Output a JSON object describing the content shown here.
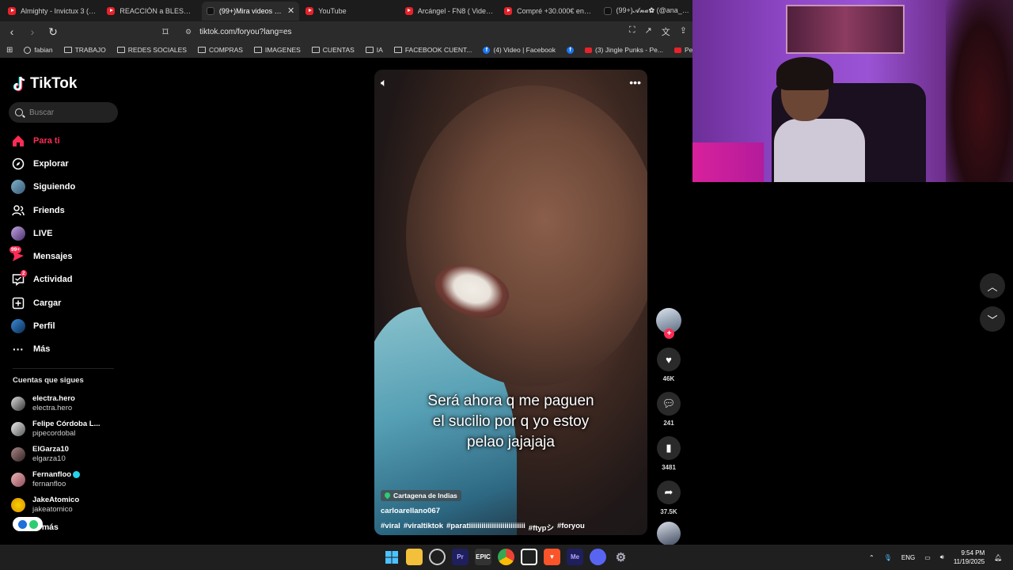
{
  "browser": {
    "tabs": [
      {
        "label": "Almighty - Invictux 3 (Tira",
        "icon": "youtube-icon",
        "active": false
      },
      {
        "label": "REACCIÓN a BLESSD - HU",
        "icon": "youtube-icon",
        "active": false
      },
      {
        "label": "(99+)Mira videos pop",
        "icon": "tiktok-icon",
        "active": true
      },
      {
        "label": "YouTube",
        "icon": "youtube-icon",
        "active": false
      },
      {
        "label": "Arcángel - FN8 ( Video Ly",
        "icon": "youtube-icon",
        "active": false
      },
      {
        "label": "Compré +30.000€ en Caja",
        "icon": "youtube-icon",
        "active": false
      },
      {
        "label": "(99+)𝓐𝓷𝓪✿ (@ana_782",
        "icon": "tiktok-icon",
        "active": false
      }
    ],
    "url": "tiktok.com/foryou?lang=es",
    "bookmarks": [
      {
        "label": "fabian",
        "icon": "globe-icon"
      },
      {
        "label": "TRABAJO",
        "icon": "folder-icon"
      },
      {
        "label": "REDES SOCIALES",
        "icon": "folder-icon"
      },
      {
        "label": "COMPRAS",
        "icon": "folder-icon"
      },
      {
        "label": "IMAGENES",
        "icon": "folder-icon"
      },
      {
        "label": "CUENTAS",
        "icon": "folder-icon"
      },
      {
        "label": "IA",
        "icon": "folder-icon"
      },
      {
        "label": "FACEBOOK CUENT...",
        "icon": "folder-icon"
      },
      {
        "label": "(4) Video | Facebook",
        "icon": "facebook-icon"
      },
      {
        "label": "",
        "icon": "facebook-icon"
      },
      {
        "label": "(3) Jingle Punks - Pe...",
        "icon": "youtube-icon"
      },
      {
        "label": "Pepo x @kazu.oficia...",
        "icon": "youtube-icon"
      }
    ]
  },
  "sidebar": {
    "logo": "TikTok",
    "search_placeholder": "Buscar",
    "menu": [
      {
        "label": "Para ti",
        "active": true
      },
      {
        "label": "Explorar"
      },
      {
        "label": "Siguiendo"
      },
      {
        "label": "Friends"
      },
      {
        "label": "LIVE"
      },
      {
        "label": "Mensajes",
        "badge": "99+"
      },
      {
        "label": "Actividad",
        "badge": "2"
      },
      {
        "label": "Cargar"
      },
      {
        "label": "Perfil"
      },
      {
        "label": "Más"
      }
    ],
    "following_title": "Cuentas que sigues",
    "following": [
      {
        "name": "electra.hero",
        "handle": "electra.hero"
      },
      {
        "name": "Felipe Córdoba L...",
        "handle": "pipecordobal"
      },
      {
        "name": "ElGarza10",
        "handle": "elgarza10"
      },
      {
        "name": "Fernanfloo",
        "handle": "fernanfloo",
        "verified": true
      },
      {
        "name": "JakeAtomico",
        "handle": "jakeatomico"
      }
    ],
    "see_more": "er más"
  },
  "video": {
    "caption": [
      "Será ahora q me paguen",
      "el sucilio  por q yo estoy",
      "pelao jajajaja"
    ],
    "location": "Cartagena de Indias",
    "author": "carloarellano067",
    "tags": [
      "#viral",
      "#viraltiktok",
      "#paratiiiiiiiiiiiiiiiiiiiiiiiiiii",
      "#ftypシ",
      "#foryou"
    ],
    "likes": "46K",
    "comments": "241",
    "saves": "3481",
    "shares": "37.5K"
  },
  "taskbar": {
    "lang": "ENG",
    "time": "9:54 PM",
    "date": "11/19/2025"
  }
}
